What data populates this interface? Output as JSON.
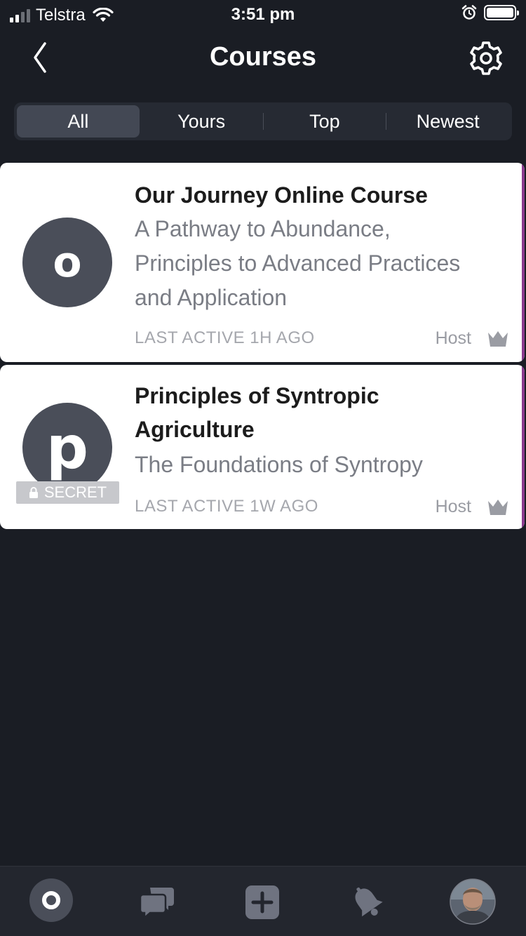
{
  "status_bar": {
    "carrier": "Telstra",
    "time": "3:51 pm"
  },
  "nav": {
    "title": "Courses"
  },
  "filters": [
    {
      "label": "All",
      "active": true
    },
    {
      "label": "Yours",
      "active": false
    },
    {
      "label": "Top",
      "active": false
    },
    {
      "label": "Newest",
      "active": false
    }
  ],
  "courses": [
    {
      "initial": "o",
      "title": "Our Journey Online Course",
      "subtitle_lines": [
        "A Pathway to Abundance,",
        "Principles to Advanced Practices",
        "and Application"
      ],
      "last_active": "LAST ACTIVE 1H AGO",
      "role": "Host"
    },
    {
      "initial": "p",
      "badge": "SECRET",
      "title_lines": [
        "Principles of Syntropic",
        "Agriculture"
      ],
      "subtitle": "The Foundations of Syntropy",
      "last_active": "LAST ACTIVE 1W AGO",
      "role": "Host"
    }
  ],
  "colors": {
    "background": "#1a1d24",
    "accent": "#8a3b8f",
    "card": "#ffffff"
  }
}
